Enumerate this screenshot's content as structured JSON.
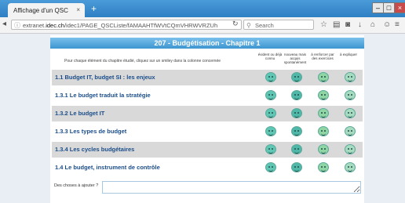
{
  "browser": {
    "tab_title": "Affichage d'un QSC",
    "tab_close": "×",
    "new_tab": "+",
    "url_prefix": "extranet.",
    "url_host": "idec.ch",
    "url_path": "/idec1/PAGE_QSCListe/fAMAAHTfWVtCQmVHRWVRZUh",
    "search_placeholder": "Search",
    "window_min": "–",
    "window_max": "□",
    "window_close": "×"
  },
  "page": {
    "title": "207 - Budgétisation - Chapitre 1",
    "instruction": "Pour chaque élément du chapitre étudié, cliquez sur un smiley dans la colonne concernée",
    "columns": [
      "évident ou déjà connu",
      "nouveau mais acquis spontanément",
      "à renforcer par des exercices",
      "à expliquer"
    ],
    "rows": [
      "1.1 Budget IT, budget SI : les enjeux",
      "1.3.1 Le budget traduit la stratégie",
      "1.3.2 Le budget IT",
      "1.3.3 Les types de budget",
      "1.3.4 Les cycles budgétaires",
      "1.4 Le budget, instrument de contrôle"
    ],
    "comment_label": "Des choses à ajouter ?"
  },
  "colors": {
    "smiley_1": "#5fc7b4",
    "smiley_2": "#4fb8a8",
    "smiley_3": "#8fd6a4",
    "smiley_4": "#a7dcc0"
  }
}
